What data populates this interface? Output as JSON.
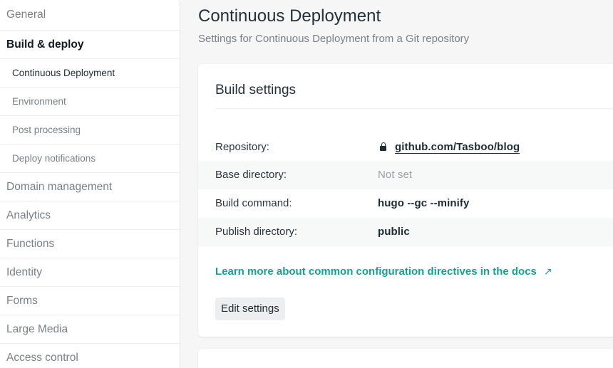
{
  "sidebar": {
    "items": [
      {
        "label": "General"
      },
      {
        "label": "Build & deploy"
      },
      {
        "label": "Continuous Deployment"
      },
      {
        "label": "Environment"
      },
      {
        "label": "Post processing"
      },
      {
        "label": "Deploy notifications"
      },
      {
        "label": "Domain management"
      },
      {
        "label": "Analytics"
      },
      {
        "label": "Functions"
      },
      {
        "label": "Identity"
      },
      {
        "label": "Forms"
      },
      {
        "label": "Large Media"
      },
      {
        "label": "Access control"
      }
    ]
  },
  "main": {
    "title": "Continuous Deployment",
    "subtitle": "Settings for Continuous Deployment from a Git repository"
  },
  "build_settings": {
    "title": "Build settings",
    "rows": [
      {
        "label": "Repository:",
        "value": "github.com/Tasboo/blog",
        "icon": "lock-icon"
      },
      {
        "label": "Base directory:",
        "value": "Not set"
      },
      {
        "label": "Build command:",
        "value": "hugo --gc --minify"
      },
      {
        "label": "Publish directory:",
        "value": "public"
      }
    ],
    "docs_link": "Learn more about common configuration directives in the docs",
    "docs_link_icon": "↗",
    "edit_button": "Edit settings"
  },
  "colors": {
    "accent": "#1a9e92",
    "text": "#1d2b33",
    "muted": "#7a8085"
  }
}
